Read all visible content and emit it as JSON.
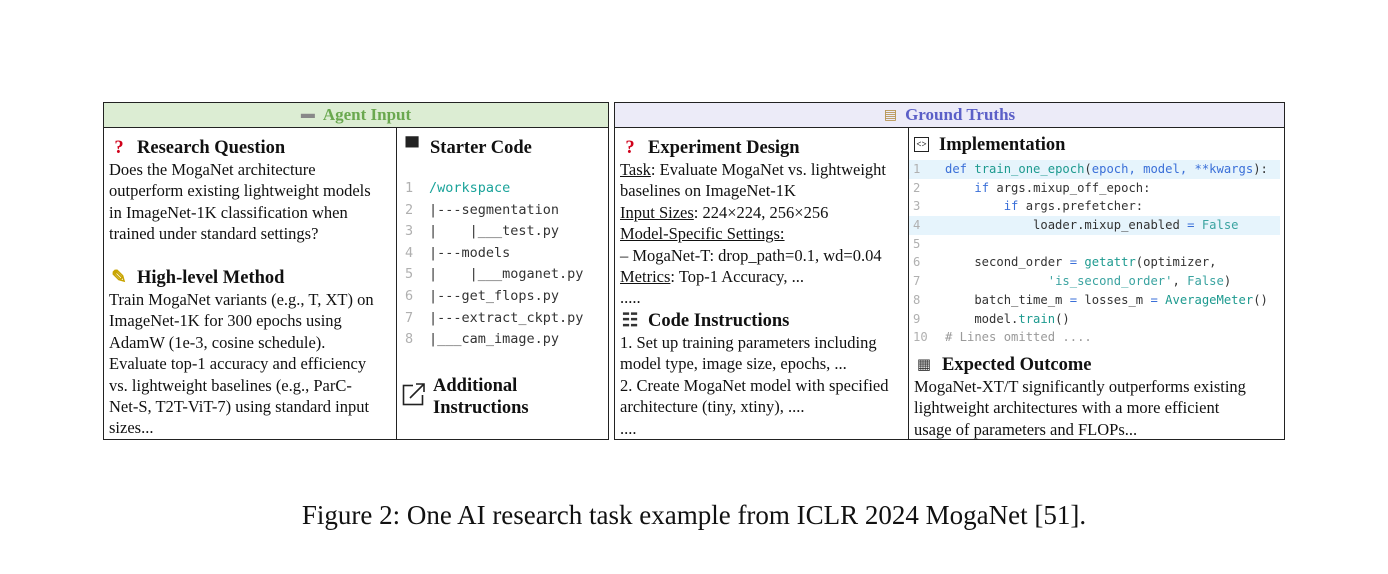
{
  "agent_input": {
    "header": "Agent Input",
    "research_question": {
      "title": "Research Question",
      "lines": [
        "Does the MogaNet architecture",
        "outperform existing lightweight models",
        "in ImageNet-1K classification when",
        "trained under standard settings?"
      ]
    },
    "high_level_method": {
      "title": "High-level Method",
      "lines": [
        "Train MogaNet variants (e.g., T, XT) on",
        "ImageNet-1K for 300 epochs using",
        "AdamW (1e-3, cosine schedule).",
        "Evaluate top-1 accuracy and efficiency",
        "vs. lightweight baselines (e.g., ParC-",
        "Net-S, T2T-ViT-7) using standard input",
        "sizes..."
      ]
    },
    "starter_code": {
      "title": "Starter Code",
      "lines": [
        {
          "n": "1",
          "text": "/workspace"
        },
        {
          "n": "2",
          "text": "|---segmentation"
        },
        {
          "n": "3",
          "text": "|    |___test.py"
        },
        {
          "n": "4",
          "text": "|---models"
        },
        {
          "n": "5",
          "text": "|    |___moganet.py"
        },
        {
          "n": "6",
          "text": "|---get_flops.py"
        },
        {
          "n": "7",
          "text": "|---extract_ckpt.py"
        },
        {
          "n": "8",
          "text": "|___cam_image.py"
        }
      ]
    },
    "additional_instructions": {
      "line1": "Additional",
      "line2": "Instructions"
    }
  },
  "ground_truths": {
    "header": "Ground Truths",
    "experiment_design": {
      "title": "Experiment Design",
      "task_label": "Task",
      "task_text": ": Evaluate MogaNet vs. lightweight",
      "task_line2": "baselines on ImageNet-1K",
      "input_label": "Input Sizes",
      "input_text": ": 224×224, 256×256",
      "model_label": "Model-Specific Settings:",
      "model_line": "– MogaNet-T: drop_path=0.1, wd=0.04",
      "metrics_label": "Metrics",
      "metrics_text": ": Top-1 Accuracy, ...",
      "ellipsis": "....."
    },
    "code_instructions": {
      "title": "Code Instructions",
      "lines": [
        "1. Set up training parameters including",
        "model type, image size, epochs, ...",
        "2. Create MogaNet model with specified",
        "architecture (tiny, xtiny), ....",
        "...."
      ]
    },
    "implementation": {
      "title": "Implementation",
      "lines": [
        {
          "n": "1",
          "text": "def train_one_epoch(epoch, model, **kwargs):"
        },
        {
          "n": "2",
          "text": "    if args.mixup_off_epoch:"
        },
        {
          "n": "3",
          "text": "        if args.prefetcher:"
        },
        {
          "n": "4",
          "text": "            loader.mixup_enabled = False"
        },
        {
          "n": "5",
          "text": ""
        },
        {
          "n": "6",
          "text": "    second_order = getattr(optimizer,"
        },
        {
          "n": "7",
          "text": "              'is_second_order', False)"
        },
        {
          "n": "8",
          "text": "    batch_time_m = losses_m = AverageMeter()"
        },
        {
          "n": "9",
          "text": "    model.train()"
        },
        {
          "n": "10",
          "text": "# Lines omitted ...."
        }
      ]
    },
    "expected_outcome": {
      "title": "Expected Outcome",
      "lines": [
        "MogaNet-XT/T significantly outperforms existing",
        "lightweight architectures with a more efficient",
        "usage of parameters and FLOPs..."
      ]
    }
  },
  "caption": "Figure 2: One AI research task example from ICLR 2024 MogaNet [51]."
}
